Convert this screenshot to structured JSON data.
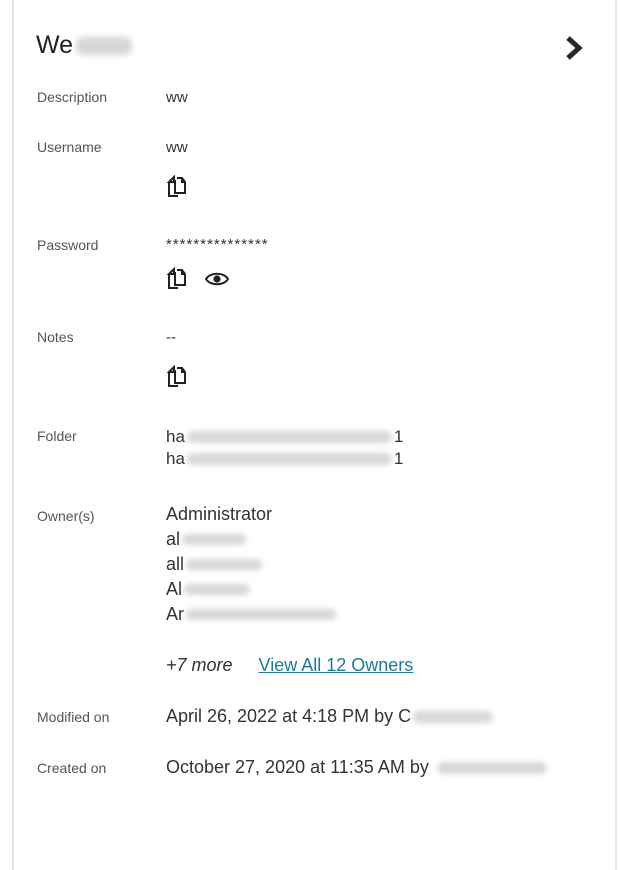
{
  "record": {
    "title": "We",
    "fields": {
      "description": {
        "label": "Description",
        "value": "ww"
      },
      "username": {
        "label": "Username",
        "value": "ww"
      },
      "password": {
        "label": "Password",
        "value": "***************"
      },
      "notes": {
        "label": "Notes",
        "value": "--"
      },
      "folder": {
        "label": "Folder",
        "lines": [
          {
            "start": "ha",
            "end": "1"
          },
          {
            "start": "ha",
            "end": "1"
          }
        ]
      },
      "owners": {
        "label": "Owner(s)",
        "list": [
          "Administrator",
          "al",
          "all",
          "Al",
          "Ar"
        ],
        "more_count": "+7 more",
        "view_all_label": "View All 12 Owners"
      },
      "modified": {
        "label": "Modified on",
        "value": "April 26, 2022 at 4:18 PM by C"
      },
      "created": {
        "label": "Created on",
        "value": "October 27, 2020 at 11:35 AM by"
      }
    }
  },
  "icons": {
    "next": "chevron-right-icon",
    "copy": "copy-icon",
    "show_password": "eye-icon"
  }
}
